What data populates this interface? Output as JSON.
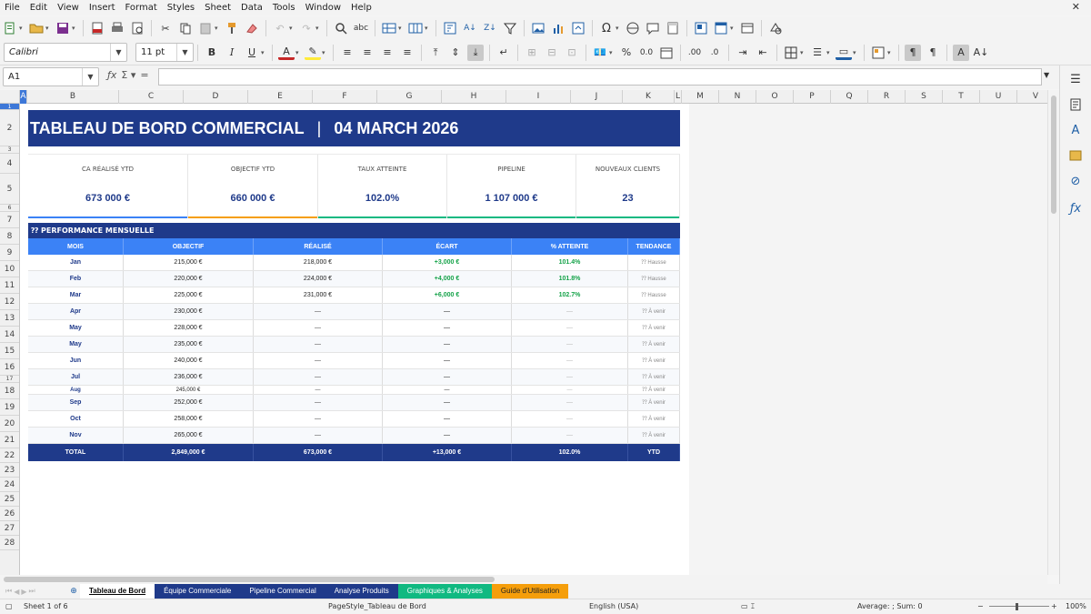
{
  "menu": [
    "File",
    "Edit",
    "View",
    "Insert",
    "Format",
    "Styles",
    "Sheet",
    "Data",
    "Tools",
    "Window",
    "Help"
  ],
  "toolbar2": {
    "font_name": "Calibri",
    "font_size": "11 pt"
  },
  "formula": {
    "cell_ref": "A1",
    "content": ""
  },
  "columns": [
    "A",
    "B",
    "C",
    "D",
    "E",
    "F",
    "G",
    "H",
    "I",
    "J",
    "K",
    "L",
    "M",
    "N",
    "O",
    "P",
    "Q",
    "R",
    "S",
    "T",
    "U",
    "V"
  ],
  "rows": [
    "1",
    "2",
    "3",
    "4",
    "5",
    "6",
    "7",
    "8",
    "9",
    "10",
    "11",
    "12",
    "13",
    "14",
    "15",
    "16",
    "17",
    "18",
    "19",
    "20",
    "21",
    "22",
    "23",
    "24",
    "25",
    "26",
    "27",
    "28"
  ],
  "dashboard": {
    "title": "TABLEAU DE BORD COMMERCIAL",
    "separator": "|",
    "date": "04 MARCH 2026",
    "kpis": [
      {
        "label": "CA RÉALISÉ YTD",
        "value": "673 000 €",
        "accent": "#3b82f6"
      },
      {
        "label": "OBJECTIF YTD",
        "value": "660 000 €",
        "accent": "#f59e0b"
      },
      {
        "label": "TAUX ATTEINTE",
        "value": "102.0%",
        "accent": "#10b981"
      },
      {
        "label": "PIPELINE",
        "value": "1 107 000 €",
        "accent": "#10b981"
      },
      {
        "label": "NOUVEAUX CLIENTS",
        "value": "23",
        "accent": "#10b981"
      }
    ],
    "section_title": "⁇ PERFORMANCE MENSUELLE",
    "table_headers": [
      "MOIS",
      "OBJECTIF",
      "RÉALISÉ",
      "ÉCART",
      "% ATTEINTE",
      "TENDANCE"
    ],
    "table_rows": [
      {
        "mois": "Jan",
        "objectif": "215,000 €",
        "realise": "218,000 €",
        "ecart": "+3,000 €",
        "atteinte": "101.4%",
        "tendance": "⁇ Hausse"
      },
      {
        "mois": "Feb",
        "objectif": "220,000 €",
        "realise": "224,000 €",
        "ecart": "+4,000 €",
        "atteinte": "101.8%",
        "tendance": "⁇ Hausse"
      },
      {
        "mois": "Mar",
        "objectif": "225,000 €",
        "realise": "231,000 €",
        "ecart": "+6,000 €",
        "atteinte": "102.7%",
        "tendance": "⁇ Hausse"
      },
      {
        "mois": "Apr",
        "objectif": "230,000 €",
        "realise": "—",
        "ecart": "—",
        "atteinte": "—",
        "tendance": "⁇ À venir"
      },
      {
        "mois": "May",
        "objectif": "228,000 €",
        "realise": "—",
        "ecart": "—",
        "atteinte": "—",
        "tendance": "⁇ À venir"
      },
      {
        "mois": "May",
        "objectif": "235,000 €",
        "realise": "—",
        "ecart": "—",
        "atteinte": "—",
        "tendance": "⁇ À venir"
      },
      {
        "mois": "Jun",
        "objectif": "240,000 €",
        "realise": "—",
        "ecart": "—",
        "atteinte": "—",
        "tendance": "⁇ À venir"
      },
      {
        "mois": "Jul",
        "objectif": "236,000 €",
        "realise": "—",
        "ecart": "—",
        "atteinte": "—",
        "tendance": "⁇ À venir"
      },
      {
        "mois": "Aug",
        "objectif": "245,000 €",
        "realise": "—",
        "ecart": "—",
        "atteinte": "—",
        "tendance": "⁇ À venir"
      },
      {
        "mois": "Sep",
        "objectif": "252,000 €",
        "realise": "—",
        "ecart": "—",
        "atteinte": "—",
        "tendance": "⁇ À venir"
      },
      {
        "mois": "Oct",
        "objectif": "258,000 €",
        "realise": "—",
        "ecart": "—",
        "atteinte": "—",
        "tendance": "⁇ À venir"
      },
      {
        "mois": "Nov",
        "objectif": "265,000 €",
        "realise": "—",
        "ecart": "—",
        "atteinte": "—",
        "tendance": "⁇ À venir"
      }
    ],
    "total": {
      "label": "TOTAL",
      "objectif": "2,849,000 €",
      "realise": "673,000 €",
      "ecart": "+13,000 €",
      "atteinte": "102.0%",
      "tendance": "YTD"
    }
  },
  "sheet_tabs": [
    {
      "label": "Tableau de Bord",
      "bg": "#ffffff",
      "color": "#000000",
      "bold": true
    },
    {
      "label": "Équipe Commerciale",
      "bg": "#1f3a8a",
      "color": "#ffffff"
    },
    {
      "label": "Pipeline Commercial",
      "bg": "#1f3a8a",
      "color": "#ffffff"
    },
    {
      "label": "Analyse Produits",
      "bg": "#1f3a8a",
      "color": "#ffffff"
    },
    {
      "label": "Graphiques & Analyses",
      "bg": "#10b981",
      "color": "#ffffff"
    },
    {
      "label": "Guide d'Utilisation",
      "bg": "#f59e0b",
      "color": "#222222"
    }
  ],
  "status": {
    "sheet": "Sheet 1 of 6",
    "page_style": "PageStyle_Tableau de Bord",
    "language": "English (USA)",
    "summary": "Average: ; Sum: 0",
    "zoom": "100%"
  },
  "icons": {
    "sidebar": [
      "properties-icon",
      "styles-icon",
      "gallery-icon",
      "navigator-icon",
      "functions-icon"
    ]
  }
}
